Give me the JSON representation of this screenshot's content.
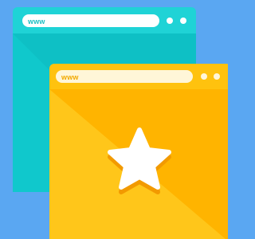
{
  "scene": {
    "background_color": "#5aa7f2"
  },
  "back_window": {
    "url_text": "www",
    "frame_color": "#1fd3d6",
    "body_color": "#10c8cc",
    "shade_color": "#0bb3b8",
    "address_bar_color": "#ffffff",
    "url_text_color": "#1bbfc3",
    "control_dots": [
      "dot",
      "dot"
    ]
  },
  "front_window": {
    "url_text": "www",
    "frame_color": "#ffc20e",
    "body_color": "#ffb400",
    "light_color": "#ffc61a",
    "address_bar_color": "#fff6d8",
    "url_text_color": "#f2a900",
    "control_dots": [
      "dot",
      "dot"
    ],
    "icon": "star-icon",
    "icon_color": "#ffffff",
    "icon_shadow_color": "#f29a00"
  }
}
